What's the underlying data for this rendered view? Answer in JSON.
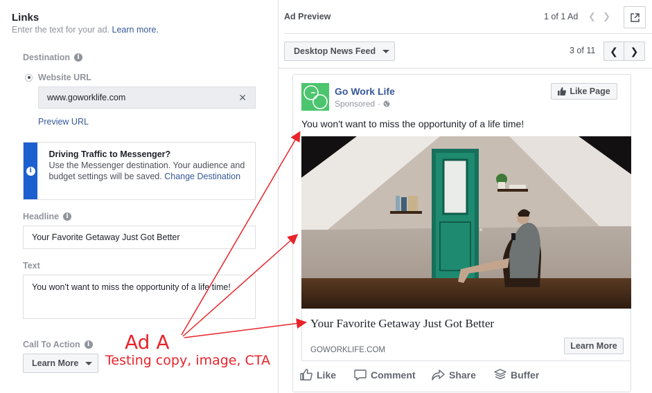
{
  "left_panel": {
    "title": "Links",
    "subtitle": "Enter the text for your ad.",
    "learn_more_link": "Learn more.",
    "destination_label": "Destination",
    "website_url_label": "Website URL",
    "website_url_value": "www.goworklife.com",
    "preview_url_link": "Preview URL",
    "messenger_notice": {
      "title": "Driving Traffic to Messenger?",
      "body": "Use the Messenger destination. Your audience and budget settings will be saved.",
      "link": "Change Destination"
    },
    "headline_label": "Headline",
    "headline_value": "Your Favorite Getaway Just Got Better",
    "text_label": "Text",
    "text_value": "You won't want to miss the opportunity of a life time!",
    "cta_label": "Call To Action",
    "cta_value": "Learn More"
  },
  "right_panel": {
    "title": "Ad Preview",
    "ad_count": "1 of 1 Ad",
    "placement": "Desktop News Feed",
    "placement_count": "3 of 11",
    "post": {
      "page_name": "Go Work Life",
      "sponsored": "Sponsored",
      "like_page_button": "Like Page",
      "text": "You won't want to miss the opportunity of a life time!",
      "headline": "Your Favorite Getaway Just Got Better",
      "domain": "GOWORKLIFE.COM",
      "cta_button": "Learn More",
      "actions": [
        "Like",
        "Comment",
        "Share",
        "Buffer"
      ]
    }
  },
  "annotation": {
    "title": "Ad A",
    "subtitle": "Testing copy, image, CTA",
    "color": "#e8232a"
  },
  "colors": {
    "link": "#365899",
    "notice_bar": "#1c5fcf",
    "logo_green": "#4cc56e"
  }
}
